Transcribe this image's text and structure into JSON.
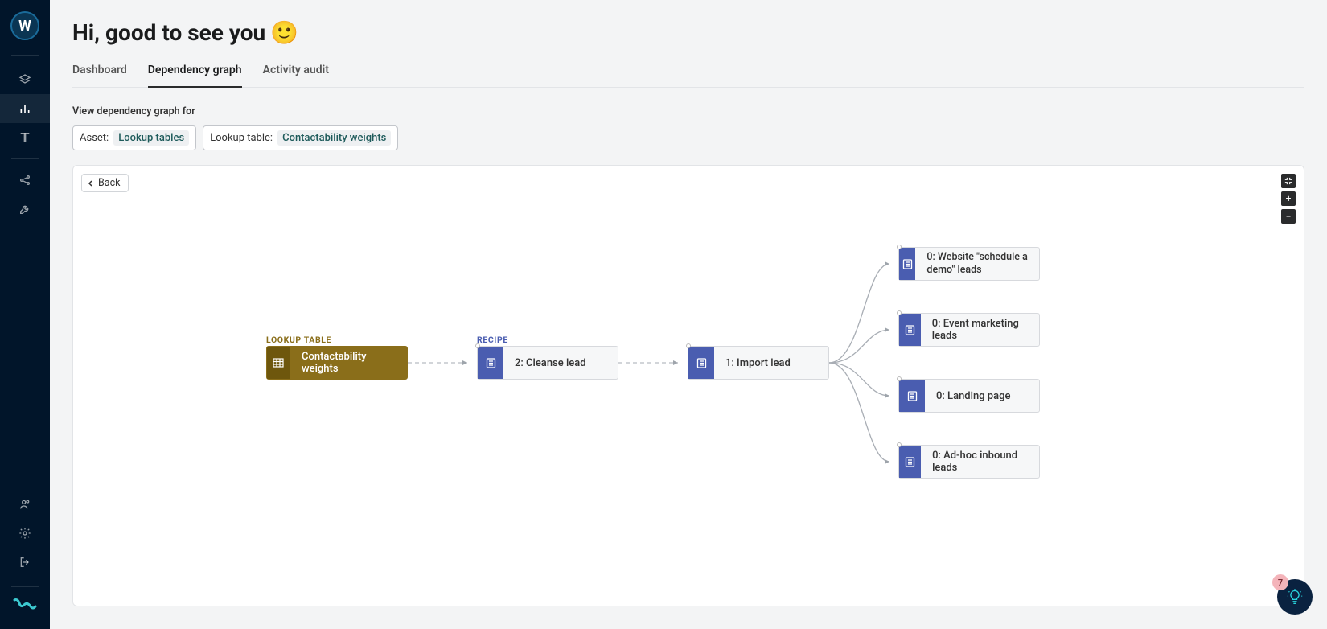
{
  "greeting": "Hi, good to see you",
  "greeting_emoji": "🙂",
  "tabs": [
    {
      "label": "Dashboard"
    },
    {
      "label": "Dependency graph"
    },
    {
      "label": "Activity audit"
    }
  ],
  "active_tab_index": 1,
  "filter_heading": "View dependency graph for",
  "filters": {
    "asset": {
      "label": "Asset:",
      "value": "Lookup tables"
    },
    "lookup": {
      "label": "Lookup table:",
      "value": "Contactability weights"
    }
  },
  "back_label": "Back",
  "notification_count": "7",
  "graph": {
    "root_label": "LOOKUP TABLE",
    "recipe_label": "RECIPE",
    "nodes": {
      "root": {
        "title": "Contactability weights"
      },
      "step2": {
        "title": "2: Cleanse lead"
      },
      "step1": {
        "title": "1: Import lead"
      },
      "leaf0": {
        "title": "0: Website \"schedule a demo\" leads"
      },
      "leaf1": {
        "title": "0: Event marketing leads"
      },
      "leaf2": {
        "title": "0: Landing page"
      },
      "leaf3": {
        "title": "0: Ad-hoc inbound leads"
      }
    }
  }
}
